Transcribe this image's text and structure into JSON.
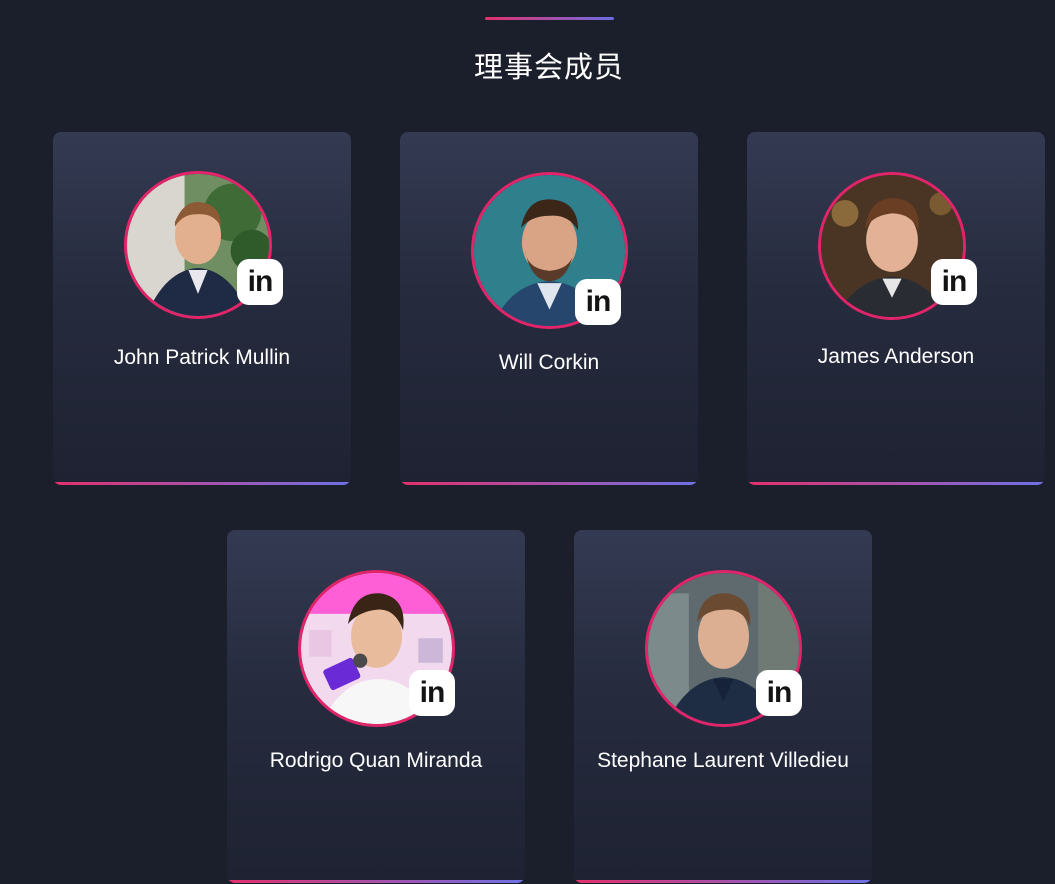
{
  "section": {
    "title": "理事会成员"
  },
  "colors": {
    "background": "#1b1e2b",
    "accent_start": "#e4306c",
    "accent_end": "#6f72e6",
    "avatar_ring": "#e2246a"
  },
  "members": [
    {
      "name": "John Patrick Mullin",
      "social_icon": "linkedin-icon",
      "social_label": "in"
    },
    {
      "name": "Will Corkin",
      "social_icon": "linkedin-icon",
      "social_label": "in"
    },
    {
      "name": "James Anderson",
      "social_icon": "linkedin-icon",
      "social_label": "in"
    },
    {
      "name": "Rodrigo Quan Miranda",
      "social_icon": "linkedin-icon",
      "social_label": "in"
    },
    {
      "name": "Stephane Laurent Villedieu",
      "social_icon": "linkedin-icon",
      "social_label": "in"
    }
  ]
}
